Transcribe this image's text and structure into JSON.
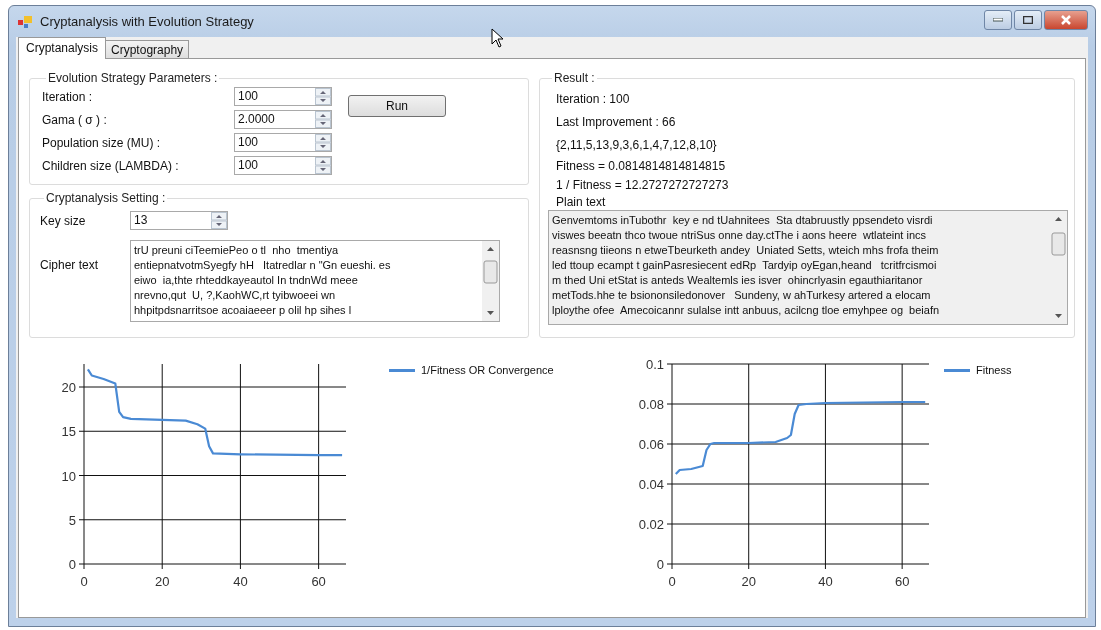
{
  "window": {
    "title": "Cryptanalysis with Evolution Strategy"
  },
  "tabs": [
    {
      "label": "Cryptanalysis",
      "selected": true
    },
    {
      "label": "Cryptography",
      "selected": false
    }
  ],
  "es_parameters": {
    "title": "Evolution Strategy Parameters :",
    "fields": [
      {
        "label": "Iteration :",
        "value": "100"
      },
      {
        "label": "Gama ( σ ) :",
        "value": "2.0000"
      },
      {
        "label": "Population size (MU) :",
        "value": "100"
      },
      {
        "label": "Children size (LAMBDA) :",
        "value": "100"
      }
    ],
    "run_button": "Run"
  },
  "cryptanalysis_setting": {
    "title": "Cryptanalysis Setting :",
    "key_size": {
      "label": "Key size",
      "value": "13"
    },
    "cipher_text": {
      "label": "Cipher text",
      "lines": [
        "trU preuni ciTeemiePeo o tl  nho  tmentiya",
        "entiepnatvotmSyegfy hH   Itatredlar n \"Gn eueshi. es",
        "eiwo  ia,thte rhteddkayeautol In tndnWd meee",
        "nrevno,qut  U, ?,KaohWC,rt tyibwoeei wn",
        "hhpitpdsnarritsoe acoaiaeeer p olil hp sihes l"
      ]
    }
  },
  "result": {
    "title": "Result :",
    "lines": [
      "Iteration : 100",
      "Last Improvement : 66",
      "{2,11,5,13,9,3,6,1,4,7,12,8,10}",
      "Fitness = 0.0814814814814815",
      "1 / Fitness = 12.2727272727273"
    ],
    "plain_text_label": "Plain text",
    "plain_text_lines": [
      "Genvemtoms inTubothr  key e nd tUahnitees  Sta dtabruustly ppsendeto visrdi",
      "viswes beeatn thco twoue ntriSus onne day.ctThe i aons heere  wtlateint incs",
      "reasnsng tiieons n etweTbeurketh andey  Uniated Setts, wteich mhs frofa theim",
      "led ttoup ecampt t gainPasresiecent edRp  Tardyip oyEgan,heand   tcritfrcismoi",
      "m thed Uni etStat is anteds Wealtemls ies isver  ohincrlyasin egauthiaritanor",
      "metTods.hhe te bsiononsiledonover   Sundeny, w ahTurkesy artered a elocam",
      "lploythe ofee  Amecoicannr sulalse intt anbuus, acilcng tloe emyhpee og  beiafn"
    ]
  },
  "charts": [
    {
      "chart_data": {
        "type": "line",
        "x": [
          1,
          2,
          5,
          8,
          9,
          10,
          12,
          20,
          26,
          29,
          31,
          32,
          33,
          40,
          60,
          66
        ],
        "series": [
          {
            "name": "1/Fitness OR Convergence",
            "color": "#4a8ad4",
            "values": [
              22,
              21.3,
              20.9,
              20.4,
              17.2,
              16.6,
              16.4,
              16.3,
              16.2,
              15.8,
              15.3,
              13.3,
              12.5,
              12.4,
              12.3,
              12.3
            ]
          }
        ],
        "grid": true,
        "xlim": [
          0,
          67
        ],
        "ylim": [
          0,
          22.6
        ],
        "xticks": [
          0,
          20,
          40,
          60
        ],
        "yticks": [
          0,
          5,
          10,
          15,
          20
        ]
      }
    },
    {
      "chart_data": {
        "type": "line",
        "x": [
          1,
          2,
          5,
          8,
          9,
          10,
          11,
          20,
          27,
          30,
          31,
          32,
          33,
          35,
          40,
          60,
          66
        ],
        "series": [
          {
            "name": "Fitness",
            "color": "#4a8ad4",
            "values": [
              0.045,
              0.047,
              0.0475,
              0.049,
              0.057,
              0.06,
              0.0605,
              0.0605,
              0.061,
              0.063,
              0.0645,
              0.075,
              0.0795,
              0.08,
              0.0805,
              0.081,
              0.081
            ]
          }
        ],
        "grid": true,
        "xlim": [
          0,
          67
        ],
        "ylim": [
          0,
          0.1
        ],
        "xticks": [
          0,
          20,
          40,
          60
        ],
        "yticks": [
          0,
          0.02,
          0.04,
          0.06,
          0.08,
          0.1
        ]
      }
    }
  ]
}
